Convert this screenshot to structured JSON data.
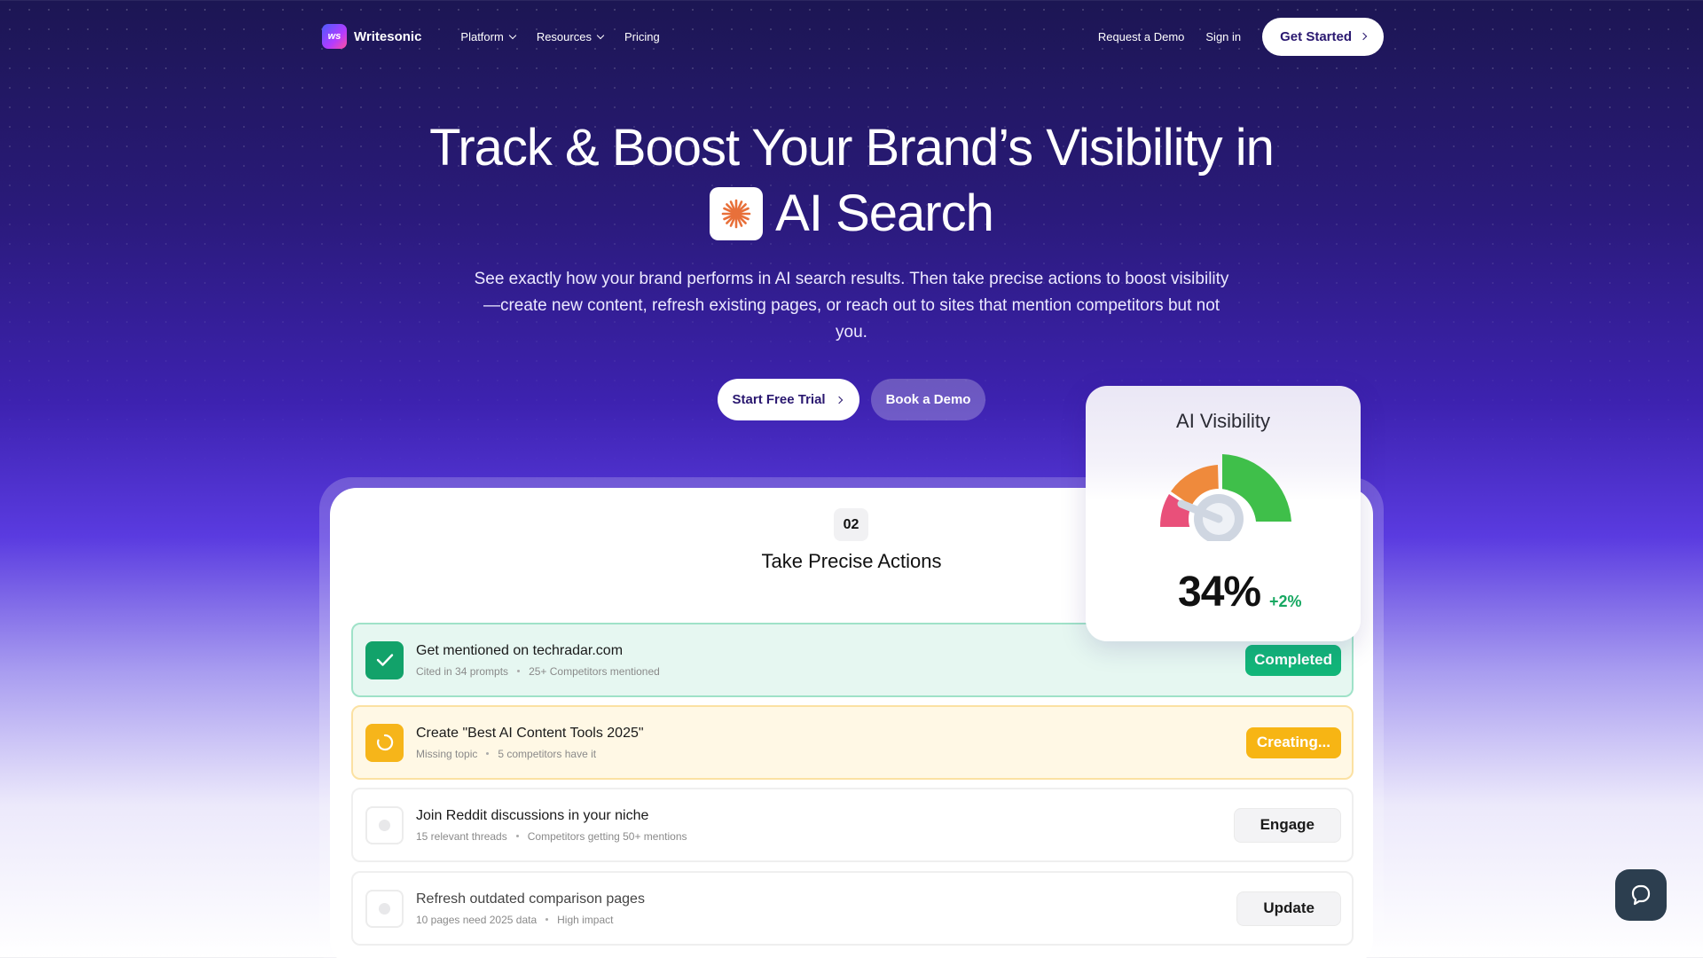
{
  "nav": {
    "logo_text": "Writesonic",
    "logo_mark": "ws",
    "links": [
      "Platform",
      "Resources",
      "Pricing"
    ],
    "request_demo": "Request a Demo",
    "sign_in": "Sign in",
    "get_started": "Get Started"
  },
  "hero": {
    "title_line1": "Track & Boost Your Brand’s Visibility in",
    "title_line2": "AI Search",
    "subtitle": "See exactly how your brand performs in AI search results. Then take precise actions to boost visibility—create new content, refresh existing pages, or reach out to sites that mention competitors but not you.",
    "cta_primary": "Start Free Trial",
    "cta_secondary": "Book a Demo"
  },
  "step": {
    "number": "02",
    "title": "Take Precise Actions"
  },
  "actions": [
    {
      "title": "Get mentioned on techradar.com",
      "meta1": "Cited in 34 prompts",
      "meta2": "25+ Competitors mentioned",
      "button": "Completed",
      "state": "completed"
    },
    {
      "title": "Create \"Best AI Content Tools 2025\"",
      "meta1": "Missing topic",
      "meta2": "5 competitors have it",
      "button": "Creating...",
      "state": "creating"
    },
    {
      "title": "Join Reddit discussions in your niche",
      "meta1": "15 relevant threads",
      "meta2": "Competitors getting 50+ mentions",
      "button": "Engage",
      "state": "pending"
    },
    {
      "title": "Refresh outdated comparison pages",
      "meta1": "10 pages need 2025 data",
      "meta2": "High impact",
      "button": "Update",
      "state": "pending"
    }
  ],
  "visibility": {
    "title": "AI Visibility",
    "value": "34%",
    "delta": "+2%",
    "gauge_fraction": 0.34
  },
  "colors": {
    "brand": "#2a1870",
    "completed": "#12b679",
    "creating": "#f7b514",
    "delta": "#17a862"
  },
  "icons": [
    "chevron-down-icon",
    "chevron-right-icon",
    "sparkle-icon",
    "check-icon",
    "spinner-icon",
    "chat-icon"
  ]
}
